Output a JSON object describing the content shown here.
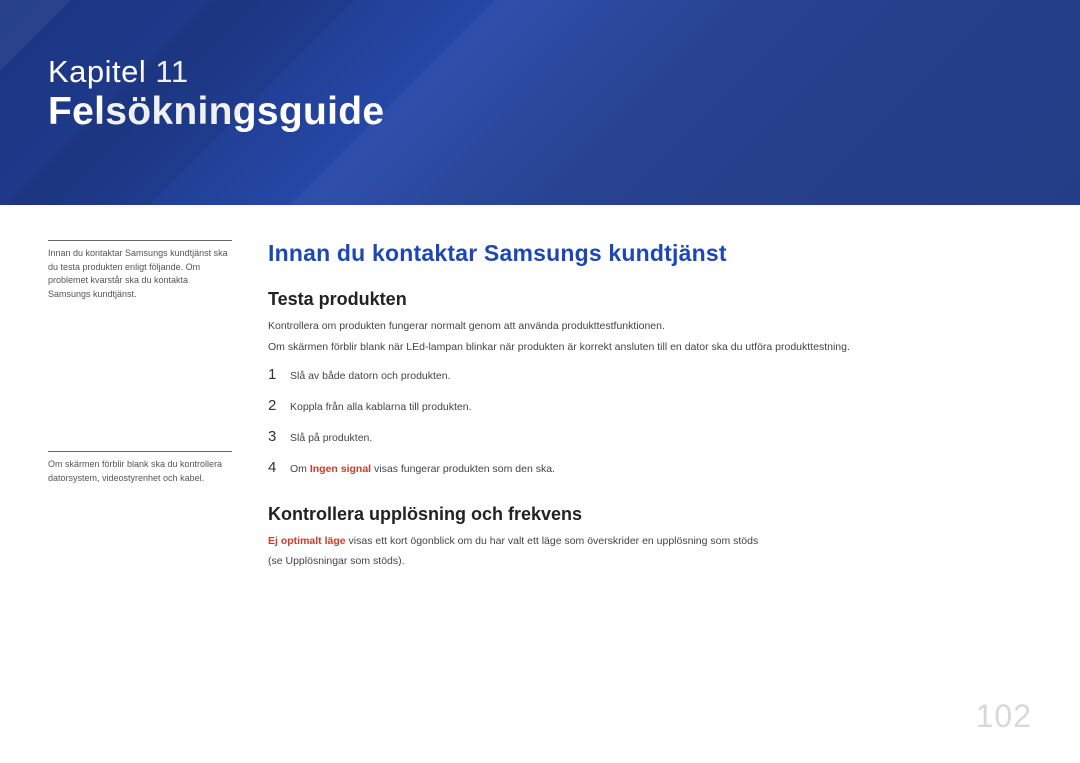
{
  "header": {
    "chapter_line": "Kapitel 11",
    "chapter_title": "Felsökningsguide"
  },
  "sidebar": {
    "note1": "Innan du kontaktar Samsungs kundtjänst ska du testa produkten enligt följande. Om problemet kvarstår ska du kontakta Samsungs kundtjänst.",
    "note2": "Om skärmen förblir blank ska du kontrollera datorsystem, videostyrenhet och kabel."
  },
  "main": {
    "section_heading": "Innan du kontaktar Samsungs kundtjänst",
    "s1": {
      "heading": "Testa produkten",
      "p1": "Kontrollera om produkten fungerar normalt genom att använda produkttestfunktionen.",
      "p2": "Om skärmen förblir blank när LEd-lampan blinkar när produkten är korrekt ansluten till en dator ska du utföra produkttestning.",
      "steps": [
        {
          "num": "1",
          "text": "Slå av både datorn och produkten."
        },
        {
          "num": "2",
          "text": "Koppla från alla kablarna till produkten."
        },
        {
          "num": "3",
          "text": "Slå på produkten."
        },
        {
          "num": "4",
          "pre": "Om ",
          "bold": "Ingen signal",
          "post": " visas fungerar produkten som den ska."
        }
      ]
    },
    "s2": {
      "heading": "Kontrollera upplösning och frekvens",
      "p1_bold": "Ej optimalt läge",
      "p1_rest": " visas ett kort ögonblick om du har valt ett läge som överskrider en upplösning som stöds",
      "p2": "(se Upplösningar som stöds)."
    }
  },
  "page_number": "102"
}
